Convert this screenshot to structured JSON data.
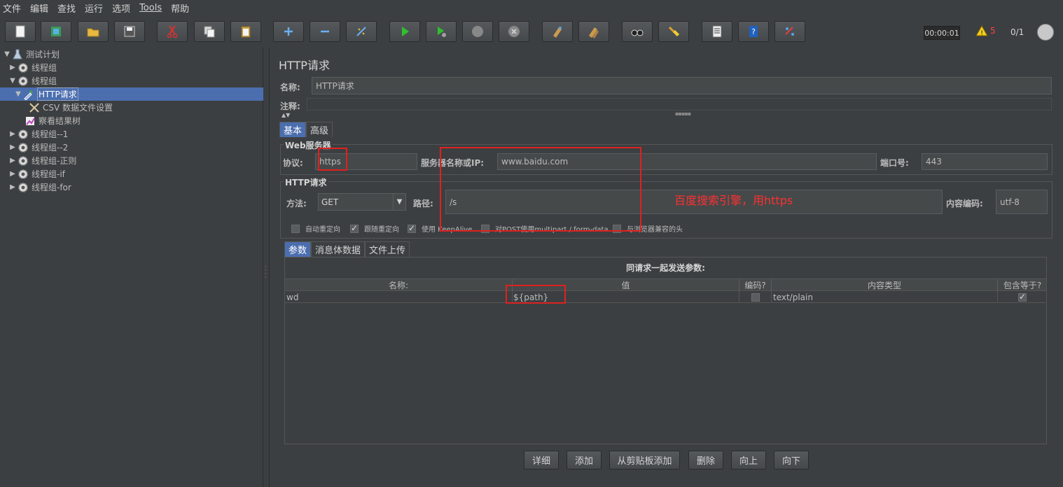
{
  "menu": [
    "文件",
    "编辑",
    "查找",
    "运行",
    "选项",
    "Tools",
    "帮助"
  ],
  "toolbar": {
    "timer": "00:00:01",
    "warning_count": "5",
    "threads": "0/1",
    "buttons": [
      "new-icon",
      "templates-icon",
      "open-icon",
      "save-icon",
      "cut-icon",
      "copy-icon",
      "paste-icon",
      "expand-icon",
      "collapse-icon",
      "toggle-icon",
      "start-icon",
      "start-no-pause-icon",
      "stop-icon",
      "shutdown-icon",
      "clear-icon",
      "clear-all-icon",
      "search-icon",
      "reset-search-icon",
      "function-helper-icon",
      "help-icon",
      "remote-icon"
    ]
  },
  "tree": {
    "items": [
      {
        "label": "测试计划",
        "arrow": "▼"
      },
      {
        "label": "线程组",
        "arrow": "▶"
      },
      {
        "label": "线程组",
        "arrow": "▼"
      },
      {
        "label": "HTTP请求",
        "arrow": "▼"
      },
      {
        "label": "CSV 数据文件设置",
        "arrow": ""
      },
      {
        "label": "察看结果树",
        "arrow": ""
      },
      {
        "label": "线程组--1",
        "arrow": "▶"
      },
      {
        "label": "线程组--2",
        "arrow": "▶"
      },
      {
        "label": "线程组-正则",
        "arrow": "▶"
      },
      {
        "label": "线程组-if",
        "arrow": "▶"
      },
      {
        "label": "线程组-for",
        "arrow": "▶"
      }
    ]
  },
  "panel": {
    "title": "HTTP请求",
    "name_label": "名称:",
    "name_value": "HTTP请求",
    "comment_label": "注释:",
    "tabs": [
      "基本",
      "高级"
    ],
    "web_server_title": "Web服务器",
    "protocol_label": "协议:",
    "protocol_value": "https",
    "server_label": "服务器名称或IP:",
    "server_value": "www.baidu.com",
    "port_label": "端口号:",
    "port_value": "443",
    "http_request_title": "HTTP请求",
    "method_label": "方法:",
    "method_value": "GET",
    "path_label": "路径:",
    "path_value": "/s",
    "encoding_label": "内容编码:",
    "encoding_value": "utf-8",
    "annotation": "百度搜索引擎，用https",
    "checkboxes": [
      {
        "label": "自动重定向",
        "checked": false
      },
      {
        "label": "跟随重定向",
        "checked": true
      },
      {
        "label": "使用 KeepAlive",
        "checked": true
      },
      {
        "label": "对POST使用multipart / form-data",
        "checked": false
      },
      {
        "label": "与浏览器兼容的头",
        "checked": false
      }
    ],
    "sub_tabs": [
      "参数",
      "消息体数据",
      "文件上传"
    ],
    "table_caption": "同请求一起发送参数:",
    "columns": [
      "名称:",
      "值",
      "编码?",
      "内容类型",
      "包含等于?"
    ],
    "rows": [
      {
        "name": "wd",
        "value": "${path}",
        "encode": false,
        "content_type": "text/plain",
        "include_equals": true
      }
    ],
    "buttons": [
      "详细",
      "添加",
      "从剪贴板添加",
      "删除",
      "向上",
      "向下"
    ]
  }
}
